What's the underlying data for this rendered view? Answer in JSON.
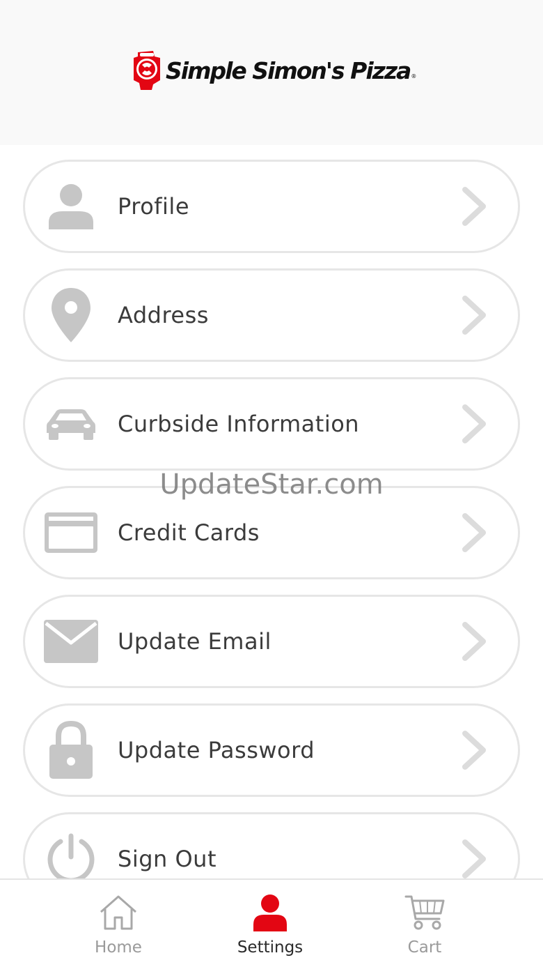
{
  "header": {
    "logo_text": "Simple Simon's Pizza",
    "logo_registered": "®",
    "brand_color": "#e30613"
  },
  "menu": {
    "items": [
      {
        "label": "Profile",
        "icon": "person-icon"
      },
      {
        "label": "Address",
        "icon": "location-pin-icon"
      },
      {
        "label": "Curbside Information",
        "icon": "car-icon"
      },
      {
        "label": "Credit Cards",
        "icon": "credit-card-icon"
      },
      {
        "label": "Update Email",
        "icon": "envelope-icon"
      },
      {
        "label": "Update Password",
        "icon": "lock-icon"
      },
      {
        "label": "Sign Out",
        "icon": "power-icon"
      }
    ]
  },
  "watermark": "UpdateStar.com",
  "tabbar": {
    "tabs": [
      {
        "label": "Home",
        "icon": "home-icon",
        "active": false
      },
      {
        "label": "Settings",
        "icon": "person-icon",
        "active": true
      },
      {
        "label": "Cart",
        "icon": "cart-icon",
        "active": false
      }
    ],
    "active_color": "#e30613",
    "inactive_color": "#9a9a9a"
  },
  "colors": {
    "icon_gray": "#c6c6c6",
    "chevron_gray": "#dcdcdc",
    "border_gray": "#e6e6e6",
    "label_text": "#3b3b3b"
  }
}
